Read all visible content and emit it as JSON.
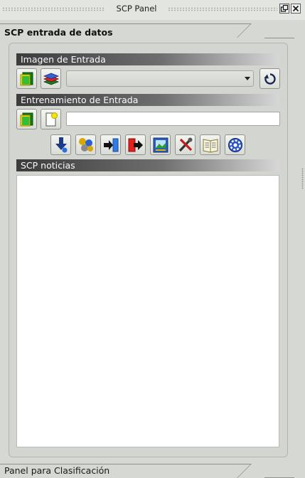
{
  "window": {
    "title": "SCP Panel",
    "float_icon": "float-icon",
    "close_icon": "close-icon"
  },
  "tabs": {
    "top": "SCP entrada de datos",
    "bottom": "Panel para Clasificación"
  },
  "input_image": {
    "header": "Imagen de Entrada",
    "selected": ""
  },
  "training": {
    "header": "Entrenamiento de Entrada",
    "value": ""
  },
  "toolbar_icons": [
    "download-icon",
    "plugins-icon",
    "import-icon",
    "export-icon",
    "screenshot-icon",
    "tools-icon",
    "book-icon",
    "settings-icon"
  ],
  "news": {
    "header": "SCP noticias",
    "content": ""
  }
}
